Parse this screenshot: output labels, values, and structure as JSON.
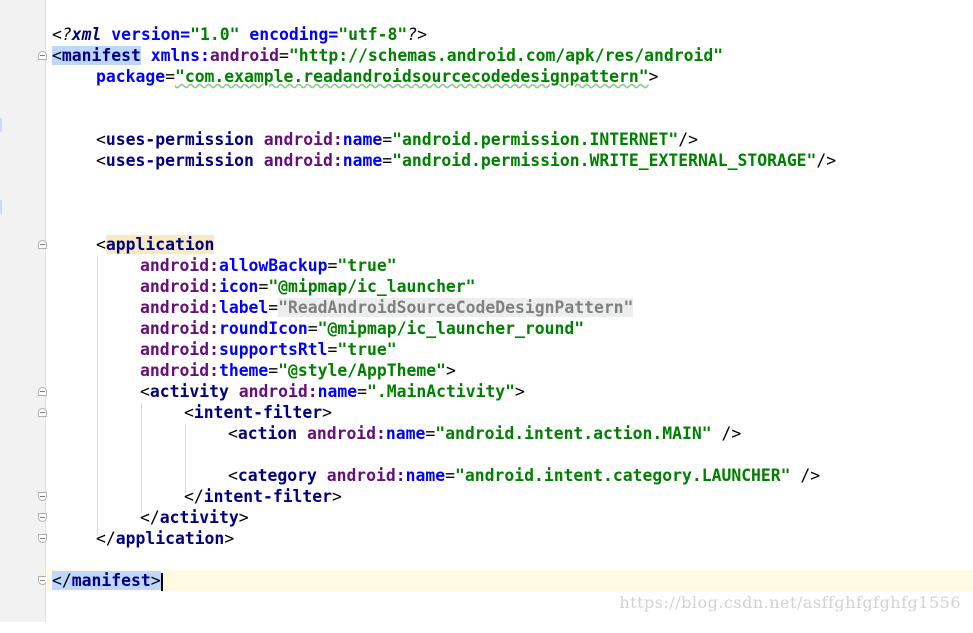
{
  "editor": {
    "lines": {
      "l1": {
        "pre": "<?",
        "tag": "xml",
        "a1": " version=",
        "v1": "\"1.0\"",
        "a2": " encoding=",
        "v2": "\"utf-8\"",
        "post": "?>"
      },
      "l2": {
        "open": "<",
        "tag": "manifest",
        "sp": " ",
        "ns": "xmlns:",
        "attr": "android",
        "eq": "=",
        "val": "\"http://schemas.android.com/apk/res/android\""
      },
      "l3": {
        "attr": "package",
        "eq": "=",
        "val": "\"com.example.readandroidsourcecodedesignpattern\"",
        "close": ">"
      },
      "l6": {
        "open": "<",
        "tag": "uses-permission",
        "ns": "android:",
        "attr": "name",
        "eq": "=",
        "val": "\"android.permission.INTERNET\"",
        "close": "/>"
      },
      "l7": {
        "open": "<",
        "tag": "uses-permission",
        "ns": "android:",
        "attr": "name",
        "eq": "=",
        "val": "\"android.permission.WRITE_EXTERNAL_STORAGE\"",
        "close": "/>"
      },
      "l11": {
        "open": "<",
        "tag": "application"
      },
      "l12": {
        "ns": "android:",
        "attr": "allowBackup",
        "eq": "=",
        "val": "\"true\""
      },
      "l13": {
        "ns": "android:",
        "attr": "icon",
        "eq": "=",
        "val": "\"@mipmap/ic_launcher\""
      },
      "l14": {
        "ns": "android:",
        "attr": "label",
        "eq": "=",
        "val": "\"ReadAndroidSourceCodeDesignPattern\""
      },
      "l15": {
        "ns": "android:",
        "attr": "roundIcon",
        "eq": "=",
        "val": "\"@mipmap/ic_launcher_round\""
      },
      "l16": {
        "ns": "android:",
        "attr": "supportsRtl",
        "eq": "=",
        "val": "\"true\""
      },
      "l17": {
        "ns": "android:",
        "attr": "theme",
        "eq": "=",
        "val": "\"@style/AppTheme\"",
        "close": ">"
      },
      "l18": {
        "open": "<",
        "tag": "activity",
        "ns": "android:",
        "attr": "name",
        "eq": "=",
        "val": "\".MainActivity\"",
        "close": ">"
      },
      "l19": {
        "open": "<",
        "tag": "intent-filter",
        "close": ">"
      },
      "l20": {
        "open": "<",
        "tag": "action",
        "ns": "android:",
        "attr": "name",
        "eq": "=",
        "val": "\"android.intent.action.MAIN\"",
        "close": " />"
      },
      "l22": {
        "open": "<",
        "tag": "category",
        "ns": "android:",
        "attr": "name",
        "eq": "=",
        "val": "\"android.intent.category.LAUNCHER\"",
        "close": " />"
      },
      "l23": {
        "open": "</",
        "tag": "intent-filter",
        "close": ">"
      },
      "l24": {
        "open": "</",
        "tag": "activity",
        "close": ">"
      },
      "l25": {
        "open": "</",
        "tag": "application",
        "close": ">"
      },
      "l27": {
        "open": "</",
        "tag": "manifest",
        "close": ">"
      }
    }
  },
  "watermark": "https://blog.csdn.net/asffghfgfghfg1556",
  "colors": {
    "tag": "#000080",
    "attr": "#0000ff",
    "namespace": "#660e7a",
    "value": "#008000",
    "current_line": "#fffae3"
  }
}
